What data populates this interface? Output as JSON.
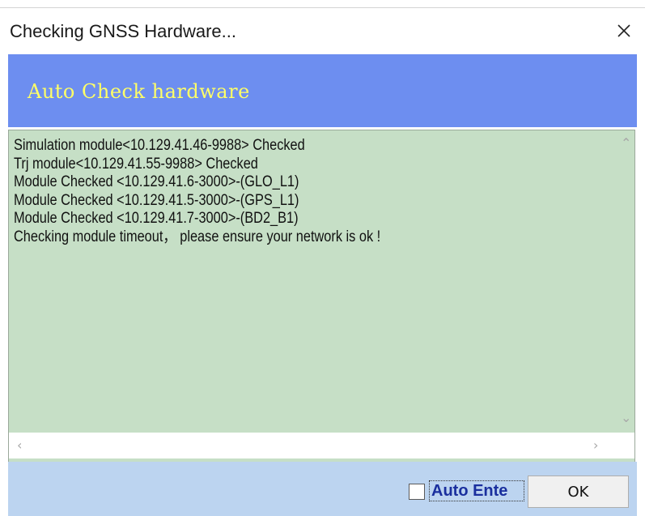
{
  "window": {
    "title": "Checking GNSS Hardware...",
    "close_icon": "close-icon"
  },
  "banner": {
    "text": "Auto Check hardware",
    "color": "#ffff66",
    "background": "#6d8ef0"
  },
  "log": {
    "background": "#c6dfc6",
    "lines": [
      "Simulation module<10.129.41.46-9988> Checked",
      "Trj module<10.129.41.55-9988> Checked",
      "Module Checked <10.129.41.6-3000>-(GLO_L1)",
      "Module Checked <10.129.41.5-3000>-(GPS_L1)",
      "Module Checked <10.129.41.7-3000>-(BD2_B1)",
      "Checking module timeout， please ensure your network is ok !"
    ]
  },
  "footer": {
    "auto_enter_label": "Auto Ente",
    "auto_enter_checked": false,
    "ok_label": "OK"
  }
}
